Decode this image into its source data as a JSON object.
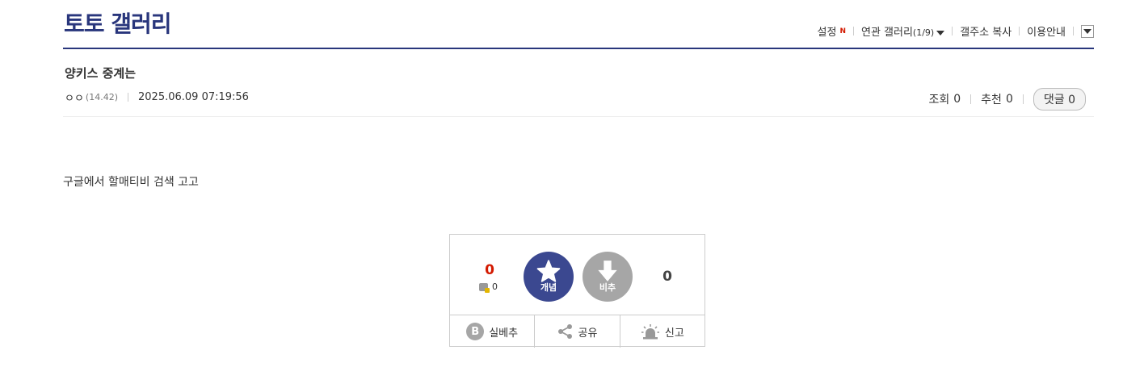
{
  "header": {
    "gallery_title": "토토 갤러리",
    "links": {
      "settings": "설정",
      "new_badge": "N",
      "related": "연관 갤러리",
      "related_count": "(1/9)",
      "copy_address": "갤주소 복사",
      "guide": "이용안내"
    }
  },
  "post": {
    "title": "양키스 중계는",
    "author": "ㅇㅇ",
    "ip": "(14.42)",
    "datetime": "2025.06.09 07:19:56",
    "views_label": "조회",
    "views": "0",
    "recommend_label": "추천",
    "recommend": "0",
    "comments_label": "댓글",
    "comments": "0",
    "body": "구글에서 할매티비 검색 고고"
  },
  "vote": {
    "up_count": "0",
    "fixed_count": "0",
    "up_label": "개념",
    "down_label": "비추",
    "down_count": "0",
    "real_down": "실베추",
    "share": "공유",
    "report": "신고",
    "b_letter": "B"
  },
  "colors": {
    "brand": "#29367c",
    "up_button": "#3b4890",
    "down_button": "#a6a6a6",
    "up_count": "#d31900"
  }
}
